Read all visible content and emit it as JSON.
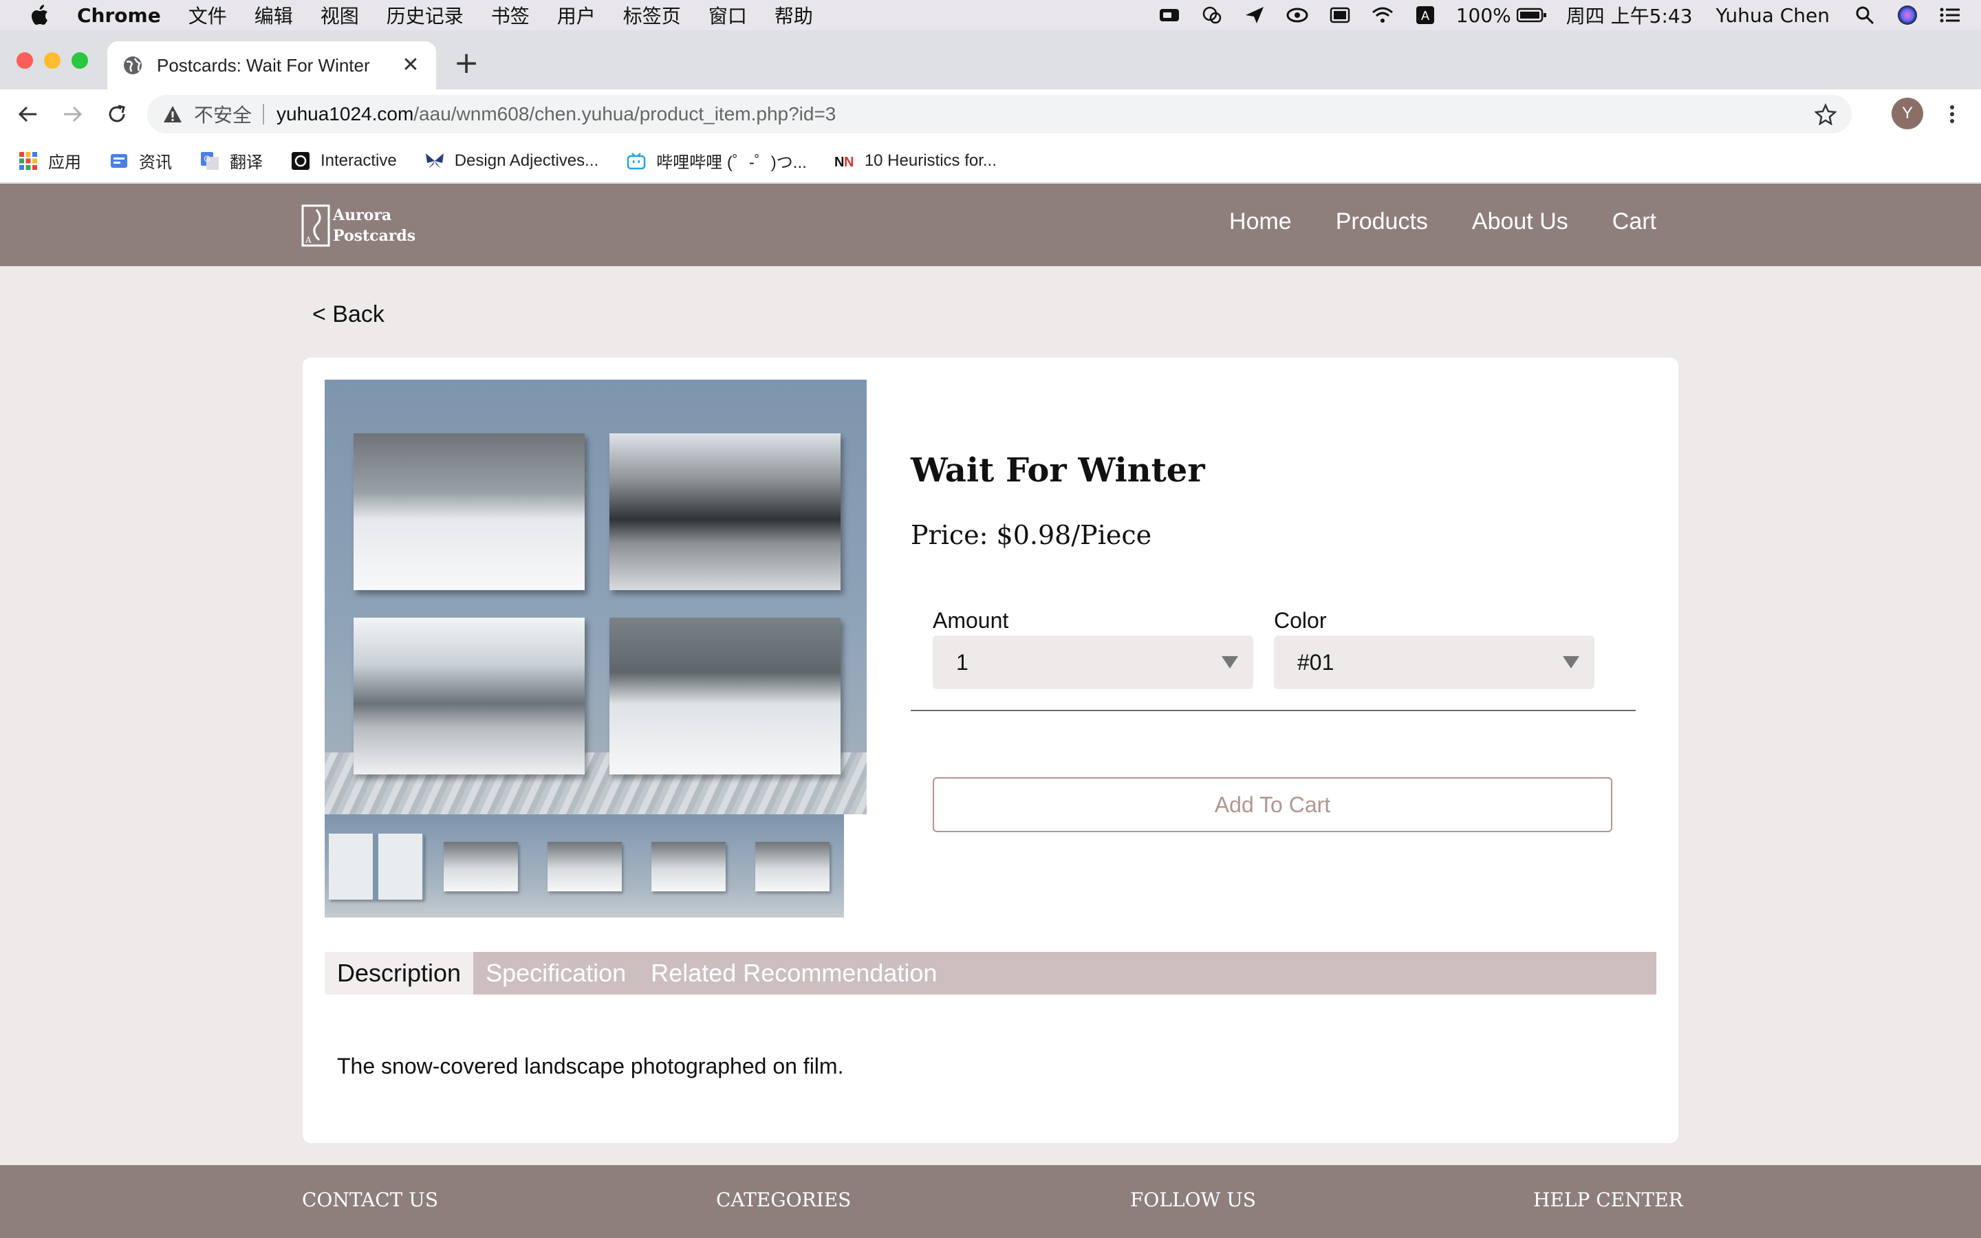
{
  "menubar": {
    "app": "Chrome",
    "items": [
      "文件",
      "编辑",
      "视图",
      "历史记录",
      "书签",
      "用户",
      "标签页",
      "窗口",
      "帮助"
    ],
    "battery": "100%",
    "datetime": "周四 上午5:43",
    "user": "Yuhua Chen",
    "input_method": "A"
  },
  "browser": {
    "tab_title": "Postcards: Wait For Winter",
    "tab_close": "✕",
    "new_tab": "+",
    "insecure_label": "不安全",
    "url_host": "yuhua1024.com",
    "url_path": "/aau/wnm608/chen.yuhua/product_item.php?id=3",
    "profile_initial": "Y",
    "bookmarks": [
      "应用",
      "资讯",
      "翻译",
      "Interactive",
      "Design Adjectives...",
      "哔哩哔哩 (゜-゜)つ...",
      "10 Heuristics for..."
    ]
  },
  "site": {
    "logo_line1": "Aurora",
    "logo_line2": "Postcards",
    "nav": [
      "Home",
      "Products",
      "About Us",
      "Cart"
    ],
    "back": "< Back"
  },
  "product": {
    "title": "Wait For Winter",
    "price": "Price: $0.98/Piece",
    "amount_label": "Amount",
    "amount_value": "1",
    "color_label": "Color",
    "color_value": "#01",
    "add_to_cart": "Add To Cart",
    "tabs": [
      "Description",
      "Specification",
      "Related Recommendation"
    ],
    "active_tab": "Description",
    "description": "The snow-covered landscape photographed on film."
  },
  "footer": {
    "headings": [
      "CONTACT US",
      "CATEGORIES",
      "FOLLOW US",
      "HELP CENTER"
    ]
  },
  "colors": {
    "header_bg": "#8e7f7d",
    "page_bg": "#eeeaea",
    "tab_bar_bg": "#cdbfbf",
    "accent": "#b19690"
  }
}
